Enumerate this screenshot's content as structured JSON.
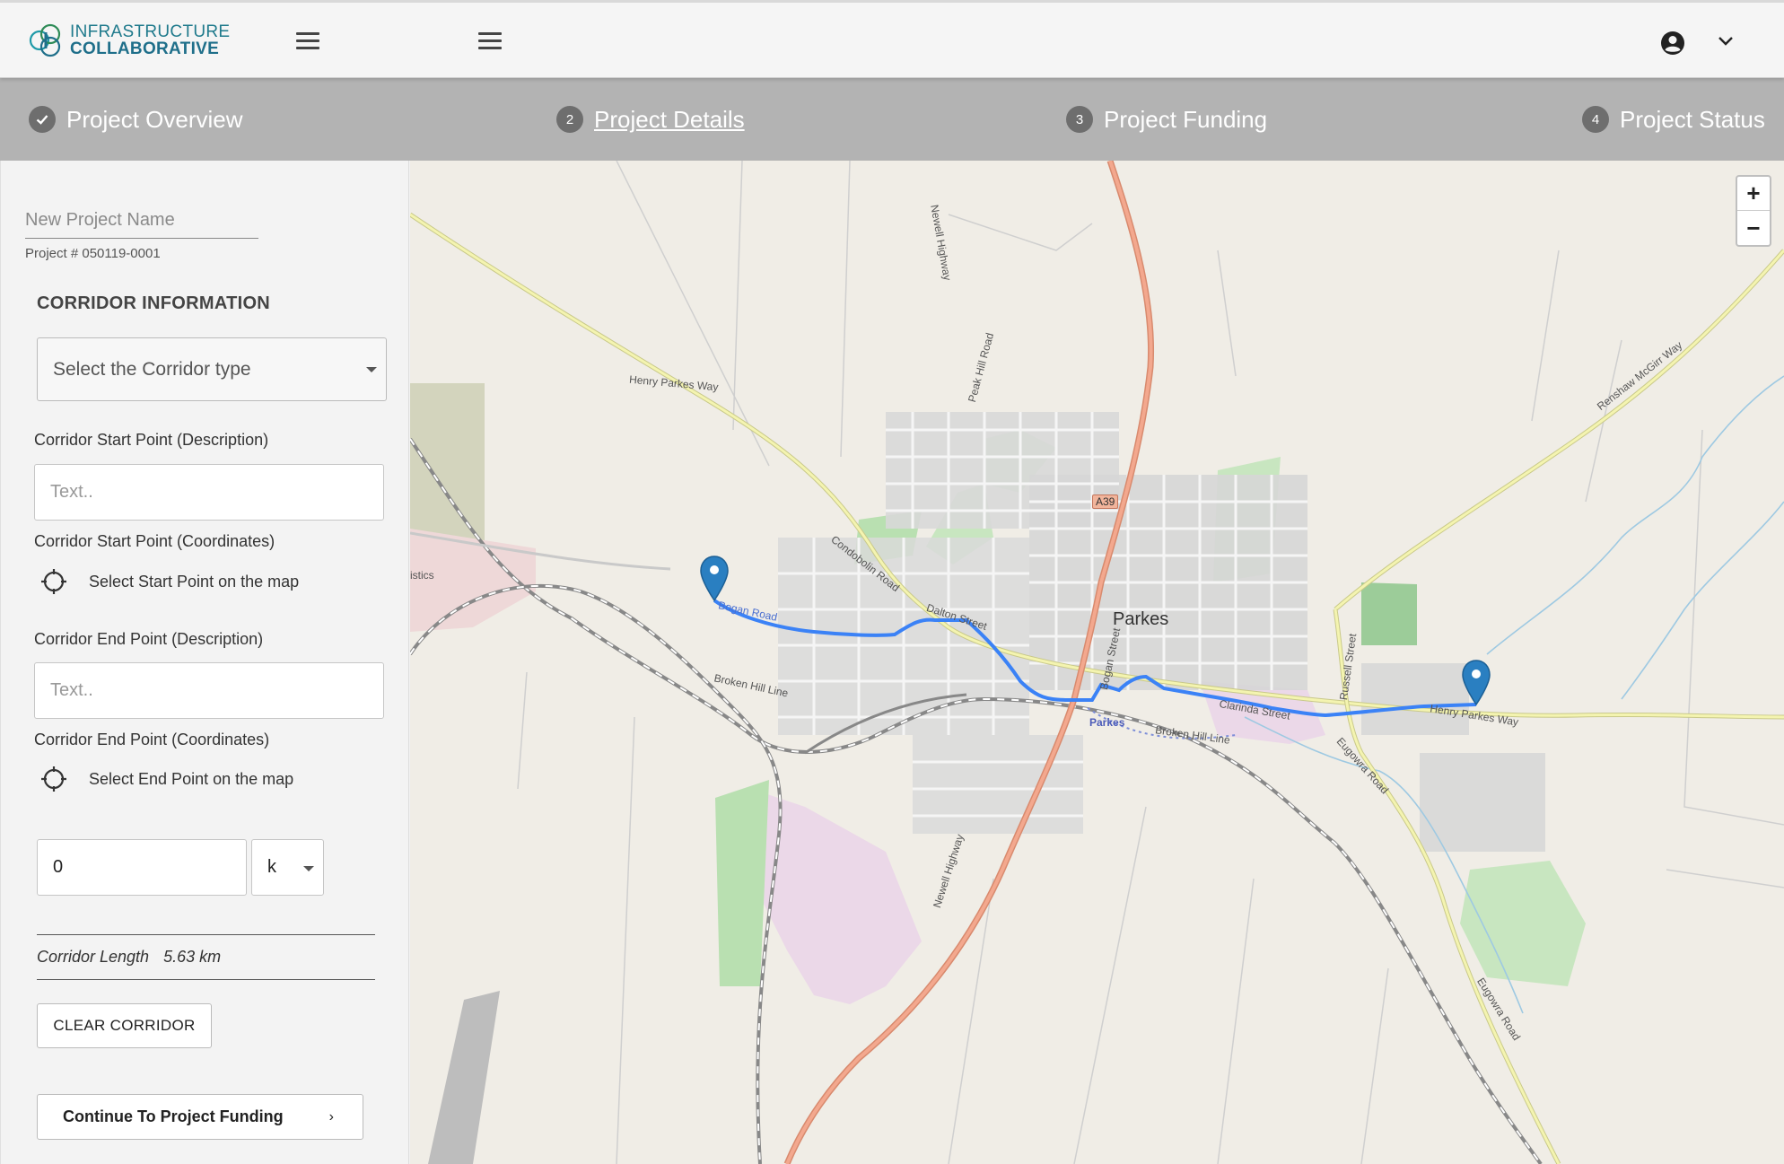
{
  "header": {
    "logo_line1": "INFRASTRUCTURE",
    "logo_line2": "COLLABORATIVE"
  },
  "stepper": {
    "steps": [
      {
        "num": "",
        "label": "Project Overview",
        "state": "done"
      },
      {
        "num": "2",
        "label": "Project Details",
        "state": "active"
      },
      {
        "num": "3",
        "label": "Project Funding",
        "state": "pending"
      },
      {
        "num": "4",
        "label": "Project Status",
        "state": "pending"
      }
    ]
  },
  "form": {
    "project_name_placeholder": "New Project Name",
    "project_number": "Project # 050119-0001",
    "section_title": "CORRIDOR INFORMATION",
    "corridor_type_placeholder": "Select the Corridor type",
    "start_desc_label": "Corridor Start Point (Description)",
    "start_desc_placeholder": "Text..",
    "start_coord_label": "Corridor Start Point (Coordinates)",
    "start_coord_action": "Select Start Point on the map",
    "end_desc_label": "Corridor End Point (Description)",
    "end_desc_placeholder": "Text..",
    "end_coord_label": "Corridor End Point (Coordinates)",
    "end_coord_action": "Select End Point on the map",
    "distance_value": "0",
    "distance_unit": "k",
    "corridor_length_label": "Corridor Length",
    "corridor_length_value": "5.63 km",
    "clear_button": "CLEAR CORRIDOR",
    "continue_button": "Continue To Project Funding",
    "continue_arrow": "›"
  },
  "map": {
    "zoom_in": "+",
    "zoom_out": "−",
    "town": "Parkes",
    "station": "Parkes",
    "labels": {
      "henry_parkes_way_w": "Henry Parkes Way",
      "henry_parkes_way_e": "Henry Parkes Way",
      "newell_highway_n": "Newell Highway",
      "newell_highway_s": "Newell Highway",
      "peak_hill_road": "Peak Hill Road",
      "condobolin_road": "Condobolin Road",
      "dalton_street": "Dalton Street",
      "bogan_street": "Bogan Street",
      "russell_street": "Russell Street",
      "clarinda_street": "Clarinda Street",
      "broken_hill_line_w": "Broken Hill Line",
      "broken_hill_line_e": "Broken Hill Line",
      "eugowra_road_1": "Eugowra Road",
      "eugowra_road_2": "Eugowra Road",
      "renshaw_mcgirr_way": "Renshaw McGirr Way",
      "road_shield": "A39",
      "logistics": "istics",
      "bogan_road": "Bogan Road"
    },
    "route_color": "#3b82f6",
    "marker_color": "#2a7fc1"
  }
}
